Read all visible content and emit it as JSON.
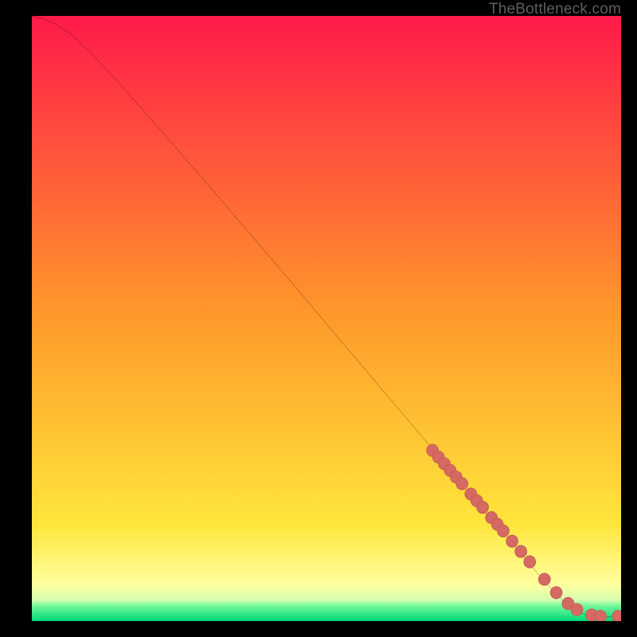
{
  "attribution": "TheBottleneck.com",
  "colors": {
    "gradient_stops": [
      {
        "offset": 0,
        "color": "#ff1a4a"
      },
      {
        "offset": 0.5,
        "color": "#ff9a2a"
      },
      {
        "offset": 0.84,
        "color": "#ffe63c"
      },
      {
        "offset": 0.94,
        "color": "#ffff9e"
      },
      {
        "offset": 0.965,
        "color": "#d7ffb0"
      },
      {
        "offset": 0.975,
        "color": "#72f79a"
      },
      {
        "offset": 1.0,
        "color": "#00d879"
      }
    ],
    "curve": "#000000",
    "marker_fill": "#d66a63",
    "marker_stroke": "#c45a53"
  },
  "chart_data": {
    "type": "line",
    "title": "",
    "subtitle": "",
    "xlabel": "",
    "ylabel": "",
    "xlim": [
      0,
      100
    ],
    "ylim": [
      0,
      100
    ],
    "series": [
      {
        "name": "bottleneck-curve",
        "x": [
          0,
          2,
          4,
          6,
          8,
          10,
          15,
          20,
          25,
          30,
          35,
          40,
          45,
          50,
          55,
          60,
          65,
          70,
          75,
          80,
          82,
          84,
          86,
          88,
          90,
          92,
          94,
          96,
          98,
          100
        ],
        "y": [
          100,
          99.5,
          98.7,
          97.4,
          95.8,
          93.9,
          88.7,
          83.2,
          77.6,
          72.0,
          66.3,
          60.6,
          54.9,
          49.1,
          43.4,
          37.6,
          31.9,
          26.1,
          20.3,
          14.6,
          12.3,
          10.0,
          7.7,
          5.5,
          3.5,
          2.0,
          1.0,
          0.7,
          0.7,
          0.7
        ]
      }
    ],
    "markers": {
      "name": "highlighted-points",
      "x": [
        68,
        69,
        70,
        71,
        72,
        73,
        74.5,
        75.5,
        76.5,
        78,
        79,
        80,
        81.5,
        83,
        84.5,
        87,
        89,
        91,
        92.5,
        95,
        96.5,
        99.5
      ],
      "y": [
        28.2,
        27.1,
        26.0,
        24.9,
        23.8,
        22.7,
        21.0,
        19.9,
        18.8,
        17.1,
        16.0,
        14.9,
        13.2,
        11.5,
        9.8,
        6.9,
        4.7,
        2.9,
        1.9,
        1.0,
        0.8,
        0.8
      ]
    },
    "annotations": []
  }
}
